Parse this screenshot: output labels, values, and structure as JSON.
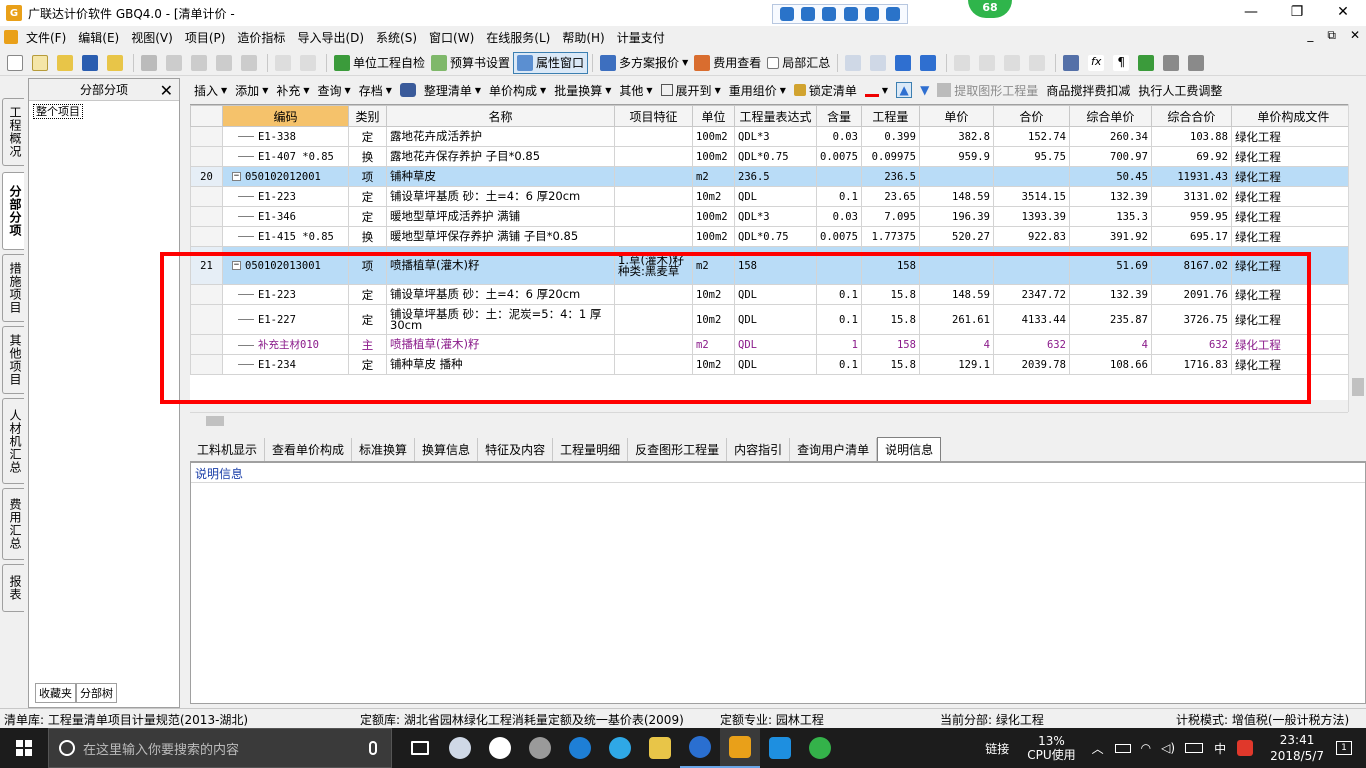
{
  "window": {
    "title": "广联达计价软件 GBQ4.0 - [清单计价 -",
    "badge": "68",
    "buttons": [
      "—",
      "❐",
      "✕"
    ]
  },
  "menu": {
    "items": [
      "文件(F)",
      "编辑(E)",
      "视图(V)",
      "项目(P)",
      "造价指标",
      "导入导出(D)",
      "系统(S)",
      "窗口(W)",
      "在线服务(L)",
      "帮助(H)",
      "计量支付"
    ],
    "mdi_buttons": [
      "_",
      "⧉",
      "✕"
    ]
  },
  "toolbar1": {
    "self_check": "单位工程自检",
    "budget_settings": "预算书设置",
    "property_window": "属性窗口",
    "multi_quote": "多方案报价",
    "fee_view": "费用查看",
    "partial_summary": "局部汇总"
  },
  "left_tabs": [
    "工程概况",
    "分部分项",
    "措施项目",
    "其他项目",
    "人材机汇总",
    "费用汇总",
    "报表"
  ],
  "left_panel": {
    "header": "分部分项",
    "tree_root": "整个项目",
    "tab_favorites": "收藏夹",
    "tab_tree": "分部树"
  },
  "toolbar2": {
    "items": [
      "插入",
      "添加",
      "补充",
      "查询",
      "存档"
    ],
    "items2": [
      "整理清单",
      "单价构成",
      "批量换算",
      "其他",
      "展开到",
      "重用组价"
    ],
    "lock": "锁定清单",
    "extract": "提取图形工程量",
    "mix_deduct": "商品搅拌费扣减",
    "labor_adjust": "执行人工费调整"
  },
  "grid": {
    "columns": [
      "编码",
      "类别",
      "名称",
      "项目特征",
      "单位",
      "工程量表达式",
      "含量",
      "工程量",
      "单价",
      "合价",
      "综合单价",
      "综合合价",
      "单价构成文件"
    ],
    "rows": [
      {
        "kind": "sub",
        "rn": "",
        "code": "E1-338",
        "cat": "定",
        "name": "露地花卉成活养护",
        "feat": "",
        "unit": "100m2",
        "expr": "QDL*3",
        "content": "0.03",
        "qty": "0.399",
        "price": "382.8",
        "total": "152.74",
        "comp_price": "260.34",
        "comp_total": "103.88",
        "file": "绿化工程"
      },
      {
        "kind": "sub",
        "rn": "",
        "code": "E1-407 *0.85",
        "cat": "换",
        "name": "露地花卉保存养护 子目*0.85",
        "feat": "",
        "unit": "100m2",
        "expr": "QDL*0.75",
        "content": "0.0075",
        "qty": "0.09975",
        "price": "959.9",
        "total": "95.75",
        "comp_price": "700.97",
        "comp_total": "69.92",
        "file": "绿化工程"
      },
      {
        "kind": "item",
        "rn": "20",
        "code": "050102012001",
        "cat": "项",
        "name": "铺种草皮",
        "feat": "",
        "unit": "m2",
        "expr": "236.5",
        "content": "",
        "qty": "236.5",
        "price": "",
        "total": "",
        "comp_price": "50.45",
        "comp_total": "11931.43",
        "file": "绿化工程"
      },
      {
        "kind": "sub",
        "rn": "",
        "code": "E1-223",
        "cat": "定",
        "name": "铺设草坪基质 砂：土=4：6 厚20cm",
        "feat": "",
        "unit": "10m2",
        "expr": "QDL",
        "content": "0.1",
        "qty": "23.65",
        "price": "148.59",
        "total": "3514.15",
        "comp_price": "132.39",
        "comp_total": "3131.02",
        "file": "绿化工程"
      },
      {
        "kind": "sub",
        "rn": "",
        "code": "E1-346",
        "cat": "定",
        "name": "暖地型草坪成活养护 满铺",
        "feat": "",
        "unit": "100m2",
        "expr": "QDL*3",
        "content": "0.03",
        "qty": "7.095",
        "price": "196.39",
        "total": "1393.39",
        "comp_price": "135.3",
        "comp_total": "959.95",
        "file": "绿化工程"
      },
      {
        "kind": "sub",
        "rn": "",
        "code": "E1-415 *0.85",
        "cat": "换",
        "name": "暖地型草坪保存养护 满铺 子目*0.85",
        "feat": "",
        "unit": "100m2",
        "expr": "QDL*0.75",
        "content": "0.0075",
        "qty": "1.77375",
        "price": "520.27",
        "total": "922.83",
        "comp_price": "391.92",
        "comp_total": "695.17",
        "file": "绿化工程"
      },
      {
        "kind": "item tall",
        "rn": "21",
        "code": "050102013001",
        "cat": "项",
        "name": "喷播植草(灌木)籽",
        "feat": "1.草(灌木)籽种类:黑麦草",
        "unit": "m2",
        "expr": "158",
        "content": "",
        "qty": "158",
        "price": "",
        "total": "",
        "comp_price": "51.69",
        "comp_total": "8167.02",
        "file": "绿化工程"
      },
      {
        "kind": "sub",
        "rn": "",
        "code": "E1-223",
        "cat": "定",
        "name": "铺设草坪基质 砂：土=4：6 厚20cm",
        "feat": "",
        "unit": "10m2",
        "expr": "QDL",
        "content": "0.1",
        "qty": "15.8",
        "price": "148.59",
        "total": "2347.72",
        "comp_price": "132.39",
        "comp_total": "2091.76",
        "file": "绿化工程"
      },
      {
        "kind": "sub tall2",
        "rn": "",
        "code": "E1-227",
        "cat": "定",
        "name": "铺设草坪基质 砂：土：泥炭=5：4：1 厚30cm",
        "feat": "",
        "unit": "10m2",
        "expr": "QDL",
        "content": "0.1",
        "qty": "15.8",
        "price": "261.61",
        "total": "4133.44",
        "comp_price": "235.87",
        "comp_total": "3726.75",
        "file": "绿化工程"
      },
      {
        "kind": "sub main",
        "rn": "",
        "code": "补充主材010",
        "cat": "主",
        "name": "喷播植草(灌木)籽",
        "feat": "",
        "unit": "m2",
        "expr": "QDL",
        "content": "1",
        "qty": "158",
        "price": "4",
        "total": "632",
        "comp_price": "4",
        "comp_total": "632",
        "file": "绿化工程"
      },
      {
        "kind": "sub",
        "rn": "",
        "code": "E1-234",
        "cat": "定",
        "name": "铺种草皮 播种",
        "feat": "",
        "unit": "10m2",
        "expr": "QDL",
        "content": "0.1",
        "qty": "15.8",
        "price": "129.1",
        "total": "2039.78",
        "comp_price": "108.66",
        "comp_total": "1716.83",
        "file": "绿化工程"
      }
    ]
  },
  "sub_tabs": [
    "工料机显示",
    "查看单价构成",
    "标准换算",
    "换算信息",
    "特征及内容",
    "工程量明细",
    "反查图形工程量",
    "内容指引",
    "查询用户清单",
    "说明信息"
  ],
  "info_title": "说明信息",
  "status": {
    "bill_lib": "清单库: 工程量清单项目计量规范(2013-湖北)",
    "quota_lib": "定额库: 湖北省园林绿化工程消耗量定额及统一基价表(2009)",
    "quota_major": "定额专业: 园林工程",
    "current_part": "当前分部: 绿化工程",
    "tax_mode": "计税模式: 增值税(一般计税方法)"
  },
  "taskbar": {
    "search_placeholder": "在这里输入你要搜索的内容",
    "link": "链接",
    "cpu_percent": "13%",
    "cpu_label": "CPU使用",
    "ime": "中",
    "time": "23:41",
    "date": "2018/5/7",
    "notifications": "1"
  },
  "colors": {
    "item_row": "#b9dcf7",
    "highlight_box": "#ff0000",
    "main_material": "#8a1a8a"
  }
}
